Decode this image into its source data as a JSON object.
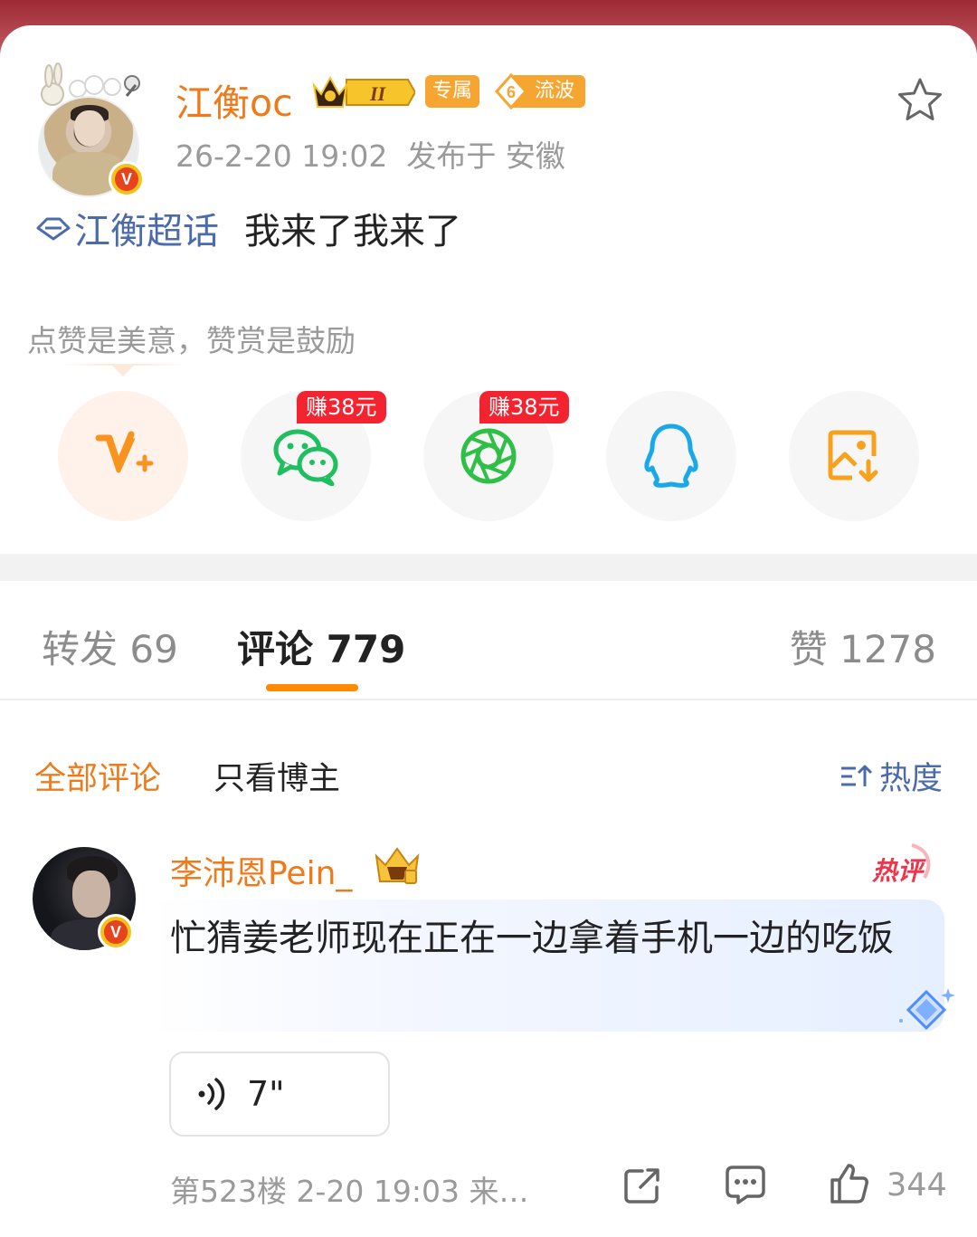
{
  "post": {
    "author": "江衡oc",
    "badges": {
      "exclusive": "专属",
      "level": "6",
      "level_label": "流波"
    },
    "meta": "26-2-20 19:02  发布于 安徽",
    "topic": "江衡超话",
    "text": "我来了我来了"
  },
  "reward": {
    "tip": "点赞是美意，赞赏是鼓励",
    "earn_label": "赚38元",
    "share_targets": [
      "reward-icon",
      "wechat-icon",
      "moments-icon",
      "qq-icon",
      "save-image-icon"
    ]
  },
  "tabs": {
    "repost": "转发 69",
    "comment": "评论 779",
    "like": "赞 1278"
  },
  "filters": {
    "all": "全部评论",
    "op_only": "只看博主",
    "sort": "热度"
  },
  "comment": {
    "author": "李沛恩Pein_",
    "hot_label": "热评",
    "text": "忙猜姜老师现在正在一边拿着手机一边的吃饭",
    "voice_length": "7\"",
    "meta": "第523楼 2-20 19:03 来…",
    "like_count": "344"
  },
  "colors": {
    "accent_orange": "#f07a1a",
    "topic_blue": "#4b6bab",
    "earn_red": "#f3232f",
    "tab_underline": "#ff8a00"
  }
}
